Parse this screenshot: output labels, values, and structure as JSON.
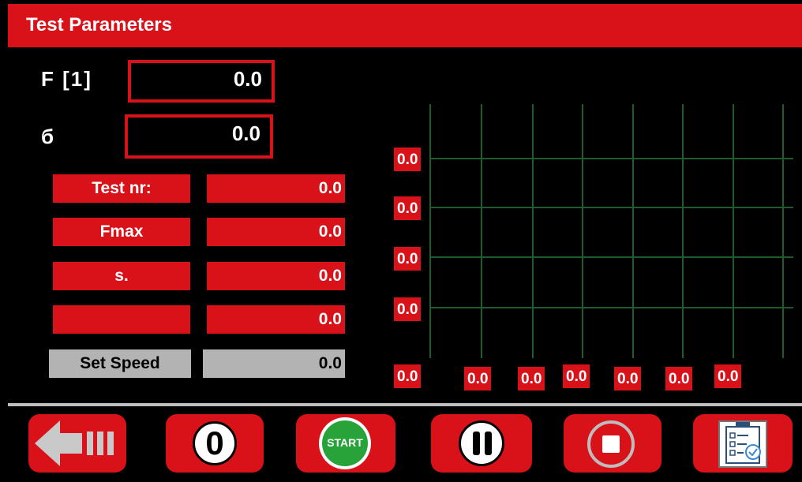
{
  "header": {
    "title": "Test Parameters"
  },
  "force": {
    "label": "F [1]",
    "value": "0.0"
  },
  "stress": {
    "label": "б",
    "value": "0.0"
  },
  "params": [
    {
      "label": "Test nr:",
      "value": "0.0"
    },
    {
      "label": "Fmax",
      "value": "0.0"
    },
    {
      "label": "s.",
      "value": "0.0"
    },
    {
      "label": "",
      "value": "0.0"
    }
  ],
  "speed": {
    "label": "Set Speed",
    "value": "0.0"
  },
  "chart": {
    "y_labels": [
      "0.0",
      "0.0",
      "0.0",
      "0.0",
      "0.0"
    ],
    "x_labels": [
      "0.0",
      "0.0",
      "0.0",
      "0.0",
      "0.0",
      "0.0"
    ]
  },
  "toolbar": {
    "back_icon": "back-arrow-icon",
    "zero_label": "0",
    "start_label": "START",
    "pause_icon": "pause-icon",
    "stop_icon": "stop-icon",
    "report_icon": "clipboard-checklist-icon"
  },
  "colors": {
    "accent": "#d9121a",
    "grid": "#1f5b2c",
    "start": "#27a33a",
    "disabled": "#b3b3b3"
  }
}
